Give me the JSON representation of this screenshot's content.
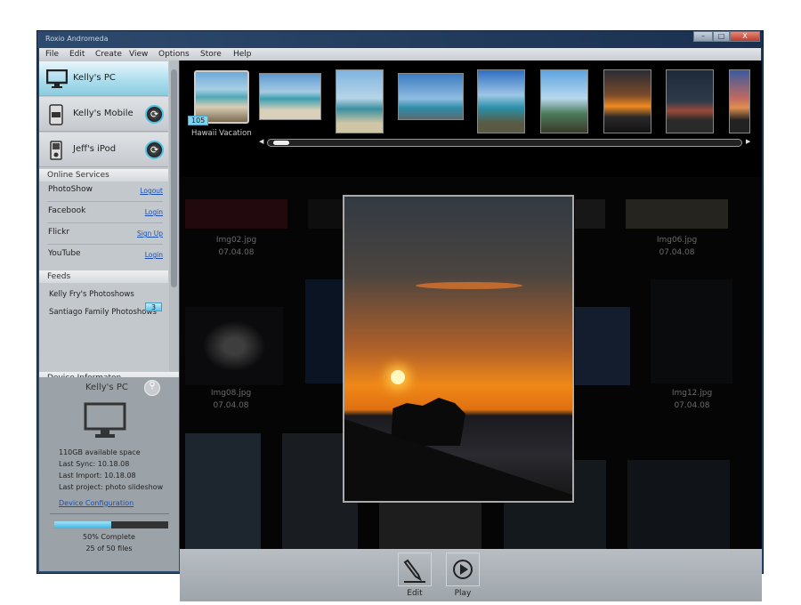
{
  "window": {
    "title": "Roxio Andromeda",
    "controls": [
      "–",
      "□",
      "X"
    ]
  },
  "menu": [
    "File",
    "Edit",
    "Create",
    "View",
    "Options",
    "Store",
    "Help"
  ],
  "devices": [
    {
      "label": "Kelly's PC",
      "icon": "monitor-icon",
      "selected": true
    },
    {
      "label": "Kelly's Mobile",
      "icon": "mobile-icon",
      "sync": true
    },
    {
      "label": "Jeff's iPod",
      "icon": "ipod-icon",
      "sync": true
    }
  ],
  "online_services": {
    "header": "Online Services",
    "items": [
      {
        "name": "PhotoShow",
        "action": "Logout"
      },
      {
        "name": "Facebook",
        "action": "Login"
      },
      {
        "name": "Flickr",
        "action": "Sign Up"
      },
      {
        "name": "YouTube",
        "action": "Login"
      }
    ]
  },
  "feeds": {
    "header": "Feeds",
    "items": [
      {
        "name": "Kelly Fry's Photoshows"
      },
      {
        "name": "Santiago Family Photoshows",
        "badge": "3"
      }
    ]
  },
  "device_info": {
    "header": "Device Informaton",
    "name": "Kelly's PC",
    "space": "110GB available space",
    "last_sync": "Last Sync: 10.18.08",
    "last_import": "Last Import: 10.18.08",
    "last_project": "Last project: photo slideshow",
    "config_link": "Device Configuration",
    "progress": 0.5,
    "progress_text": "50% Complete",
    "files_text": "25 of 50 files"
  },
  "album": {
    "name": "Hawaii Vacation",
    "count": "105"
  },
  "grid": [
    {
      "file": "Img02.jpg",
      "date": "07.04.08"
    },
    {
      "file": "Img06.jpg",
      "date": "07.04.08"
    },
    {
      "file": "Img08.jpg",
      "date": "07.04.08"
    },
    {
      "file": "Img12.jpg",
      "date": "07.04.08"
    }
  ],
  "toolbar": {
    "edit": "Edit",
    "play": "Play"
  },
  "colors": {
    "accent": "#4bc2e8",
    "link": "#1a4fb5"
  }
}
